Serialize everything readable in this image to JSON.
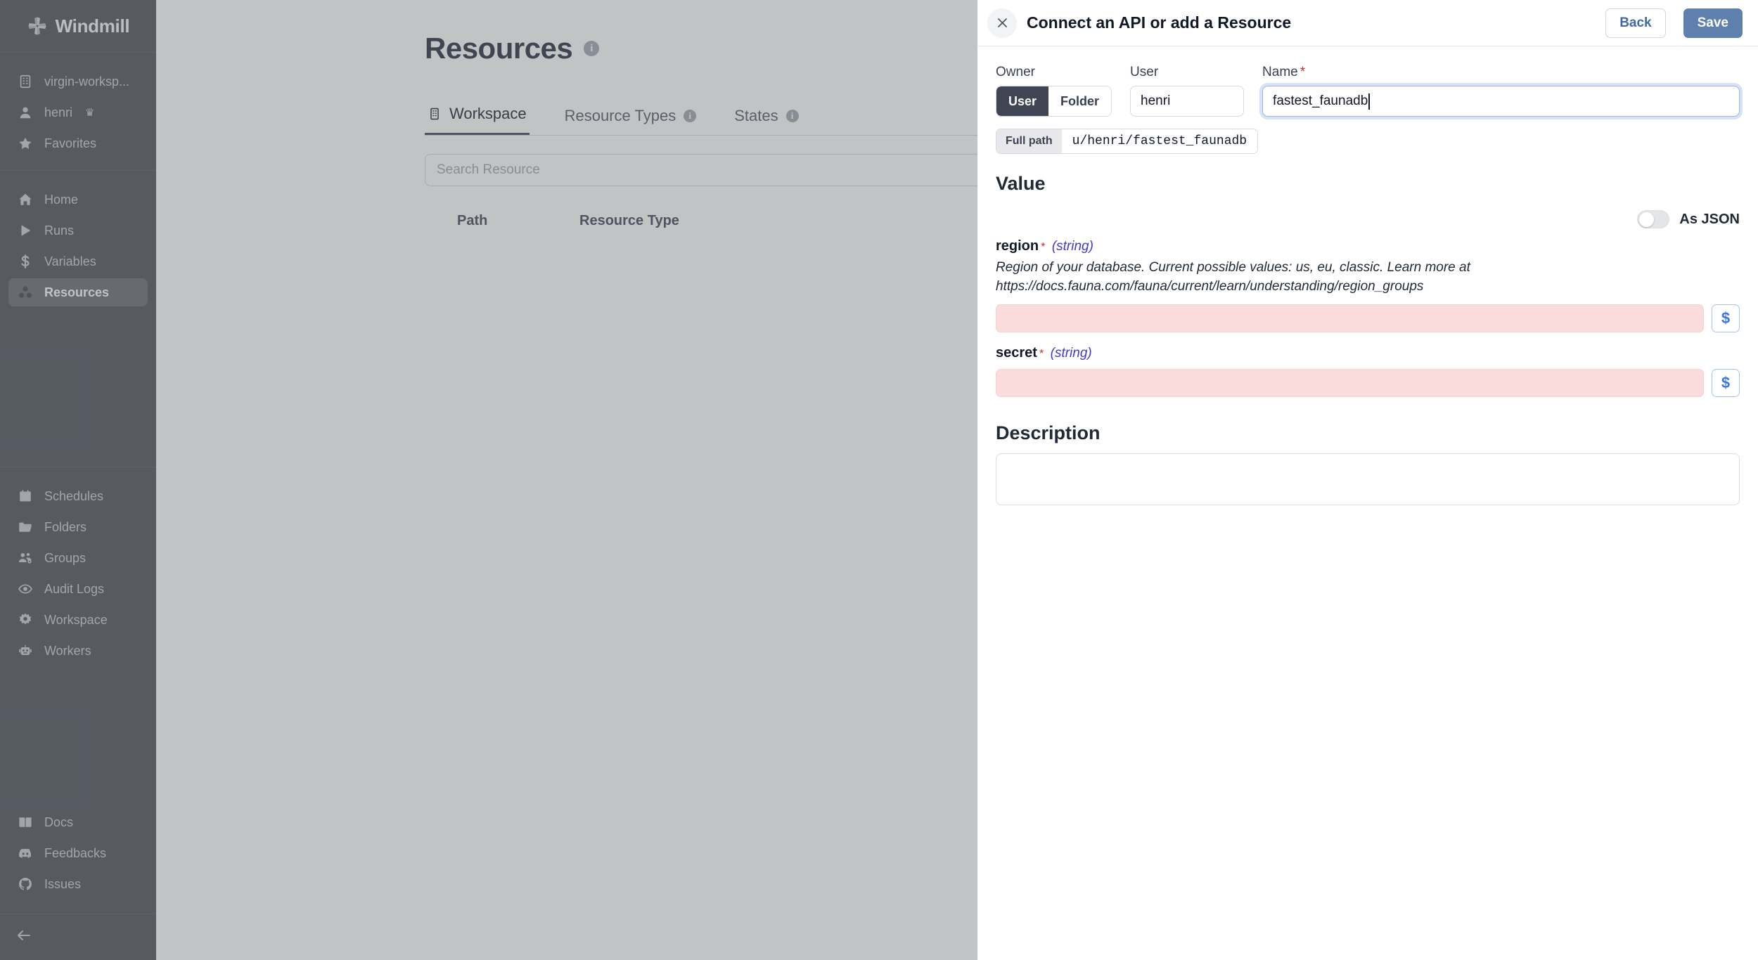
{
  "sidebar": {
    "brand": "Windmill",
    "workspace": {
      "label": "virgin-worksp...",
      "icon": "building-icon"
    },
    "user": {
      "label": "henri",
      "icon": "user-icon",
      "badge": "♛"
    },
    "favorites": {
      "label": "Favorites",
      "icon": "star-icon"
    },
    "primary_items": [
      {
        "label": "Home",
        "icon": "home-icon",
        "active": false
      },
      {
        "label": "Runs",
        "icon": "play-icon",
        "active": false
      },
      {
        "label": "Variables",
        "icon": "dollar-icon",
        "active": false
      },
      {
        "label": "Resources",
        "icon": "resources-icon",
        "active": true
      }
    ],
    "secondary_items": [
      {
        "label": "Schedules",
        "icon": "calendar-icon"
      },
      {
        "label": "Folders",
        "icon": "folder-icon"
      },
      {
        "label": "Groups",
        "icon": "groups-icon"
      },
      {
        "label": "Audit Logs",
        "icon": "eye-icon"
      },
      {
        "label": "Workspace",
        "icon": "gear-icon"
      },
      {
        "label": "Workers",
        "icon": "robot-icon"
      }
    ],
    "footer_items": [
      {
        "label": "Docs",
        "icon": "book-icon"
      },
      {
        "label": "Feedbacks",
        "icon": "discord-icon"
      },
      {
        "label": "Issues",
        "icon": "github-icon"
      }
    ],
    "collapse": {
      "icon": "arrow-left-icon"
    }
  },
  "main": {
    "page_title": "Resources",
    "tabs": [
      {
        "label": "Workspace",
        "icon": "building-icon",
        "info": true,
        "active": true
      },
      {
        "label": "Resource Types",
        "icon": "",
        "info": true,
        "active": false
      },
      {
        "label": "States",
        "icon": "",
        "info": true,
        "active": false
      }
    ],
    "search": {
      "placeholder": "Search Resource",
      "value": ""
    },
    "table": {
      "columns": [
        "Path",
        "Resource Type"
      ],
      "rows": []
    }
  },
  "drawer": {
    "title": "Connect an API or add a Resource",
    "close_icon": "close-icon",
    "back_label": "Back",
    "save_label": "Save",
    "owner": {
      "label": "Owner",
      "options": [
        "User",
        "Folder"
      ],
      "selected": "User"
    },
    "user": {
      "label": "User",
      "value": "henri"
    },
    "name": {
      "label": "Name",
      "value": "fastest_faunadb",
      "required": true
    },
    "full_path": {
      "label": "Full path",
      "value": "u/henri/fastest_faunadb"
    },
    "value_section": {
      "title": "Value",
      "as_json": {
        "label": "As JSON",
        "enabled": false
      },
      "properties": [
        {
          "name": "region",
          "type": "(string)",
          "required": true,
          "description": "Region of your database. Current possible values: us, eu, classic. Learn more at https://docs.fauna.com/fauna/current/learn/understanding/region_groups",
          "value": "",
          "error": true,
          "dollar_label": "$"
        },
        {
          "name": "secret",
          "type": "(string)",
          "required": true,
          "description": "",
          "value": "",
          "error": true,
          "dollar_label": "$"
        }
      ]
    },
    "description_section": {
      "title": "Description",
      "value": "",
      "placeholder": ""
    }
  },
  "colors": {
    "sidebar_bg": "#474b54",
    "save_button": "#5f7fad",
    "error_field": "#fbdcdc",
    "dollar_blue": "#3b76e8",
    "required_red": "#dc2626",
    "type_purple": "#4338ca"
  }
}
